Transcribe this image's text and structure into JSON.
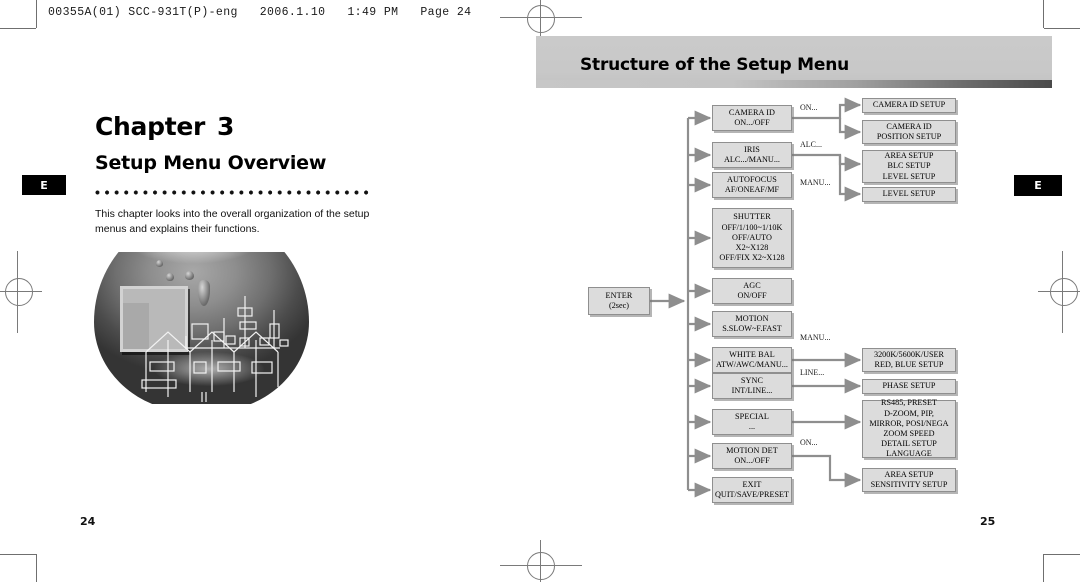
{
  "slug": "00355A(01) SCC-931T(P)-eng   2006.1.10   1:49 PM   Page 24",
  "left_page": {
    "chapter_label": "Chapter",
    "chapter_number": "3",
    "subtitle": "Setup Menu Overview",
    "body": "This chapter looks into the overall organization of the setup menus and explains their functions.",
    "tab_label": "E",
    "page_number": "24"
  },
  "right_page": {
    "banner_title": "Structure of the Setup Menu",
    "tab_label": "E",
    "page_number": "25"
  },
  "diagram": {
    "enter": {
      "line1": "ENTER",
      "line2": "(2sec)"
    },
    "menu_items": [
      {
        "title": "CAMERA ID",
        "lines": [
          "ON.../OFF"
        ]
      },
      {
        "title": "IRIS",
        "lines": [
          "ALC.../MANU..."
        ]
      },
      {
        "title": "AUTOFOCUS",
        "lines": [
          "AF/ONEAF/MF"
        ]
      },
      {
        "title": "SHUTTER",
        "lines": [
          "OFF/1/100~1/10K",
          "OFF/AUTO",
          "X2~X128",
          "OFF/FIX X2~X128"
        ]
      },
      {
        "title": "AGC",
        "lines": [
          "ON/OFF"
        ]
      },
      {
        "title": "MOTION",
        "lines": [
          "S.SLOW~F.FAST"
        ]
      },
      {
        "title": "WHITE BAL",
        "lines": [
          "ATW/AWC/MANU..."
        ]
      },
      {
        "title": "SYNC",
        "lines": [
          "INT/LINE..."
        ]
      },
      {
        "title": "SPECIAL",
        "lines": [
          "..."
        ]
      },
      {
        "title": "MOTION DET",
        "lines": [
          "ON.../OFF"
        ]
      },
      {
        "title": "EXIT",
        "lines": [
          "QUIT/SAVE/PRESET"
        ]
      }
    ],
    "sub_items": [
      {
        "lines": [
          "CAMERA ID SETUP"
        ]
      },
      {
        "lines": [
          "CAMERA ID",
          "POSITION SETUP"
        ]
      },
      {
        "lines": [
          "AREA SETUP",
          "BLC SETUP",
          "LEVEL SETUP"
        ]
      },
      {
        "lines": [
          "LEVEL SETUP"
        ]
      },
      {
        "lines": [
          "3200K/5600K/USER",
          "RED, BLUE SETUP"
        ]
      },
      {
        "lines": [
          "PHASE SETUP"
        ]
      },
      {
        "lines": [
          "RS485, PRESET",
          "D-ZOOM, PIP,",
          "MIRROR, POSI/NEGA",
          "ZOOM SPEED",
          "DETAIL SETUP",
          "LANGUAGE"
        ]
      },
      {
        "lines": [
          "AREA SETUP",
          "SENSITIVITY SETUP"
        ]
      }
    ],
    "edge_labels": [
      "ON...",
      "ALC...",
      "MANU...",
      "MANU...",
      "LINE...",
      "ON..."
    ]
  }
}
